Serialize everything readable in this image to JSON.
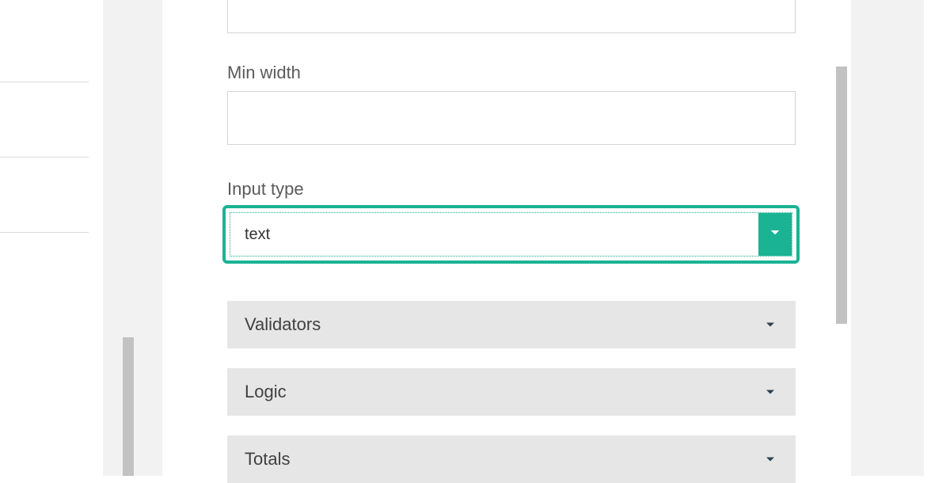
{
  "fields": {
    "top_input": {
      "value": ""
    },
    "min_width": {
      "label": "Min width",
      "value": ""
    },
    "input_type": {
      "label": "Input type",
      "selected": "text"
    }
  },
  "sections": {
    "validators": {
      "label": "Validators"
    },
    "logic": {
      "label": "Logic"
    },
    "totals": {
      "label": "Totals"
    }
  },
  "colors": {
    "accent": "#1ab394",
    "section_bg": "#e6e6e6",
    "border": "#d4d4d4"
  }
}
